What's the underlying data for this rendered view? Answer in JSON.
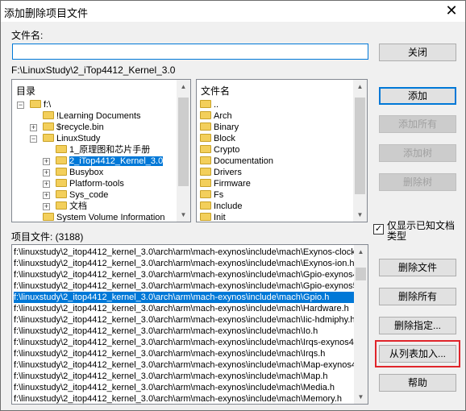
{
  "window": {
    "title": "添加删除项目文件",
    "close_glyph": "✕"
  },
  "filename_label": "文件名:",
  "filename_value": "",
  "current_path": "F:\\LinuxStudy\\2_iTop4412_Kernel_3.0",
  "dir_header": "目录",
  "file_header": "文件名",
  "dir_tree": [
    {
      "label": "f:\\",
      "expander": "−"
    },
    {
      "label": "!Learning Documents",
      "expander": ""
    },
    {
      "label": "$recycle.bin",
      "expander": "+"
    },
    {
      "label": "LinuxStudy",
      "expander": "−"
    },
    {
      "label": "1_原理图和芯片手册",
      "expander": ""
    },
    {
      "label": "2_iTop4412_Kernel_3.0",
      "expander": "+",
      "selected": true
    },
    {
      "label": "Busybox",
      "expander": "+"
    },
    {
      "label": "Platform-tools",
      "expander": "+"
    },
    {
      "label": "Sys_code",
      "expander": "+"
    },
    {
      "label": "文档",
      "expander": "+"
    },
    {
      "label": "System Volume Information",
      "expander": ""
    }
  ],
  "file_list": [
    "..",
    "Arch",
    "Binary",
    "Block",
    "Crypto",
    "Documentation",
    "Drivers",
    "Firmware",
    "Fs",
    "Include",
    "Init"
  ],
  "project_files_label": "项目文件: (3188)",
  "project_files": [
    {
      "path": "f:\\linuxstudy\\2_itop4412_kernel_3.0\\arch\\arm\\mach-exynos\\include\\mach\\Exynos-clock"
    },
    {
      "path": "f:\\linuxstudy\\2_itop4412_kernel_3.0\\arch\\arm\\mach-exynos\\include\\mach\\Exynos-ion.h"
    },
    {
      "path": "f:\\linuxstudy\\2_itop4412_kernel_3.0\\arch\\arm\\mach-exynos\\include\\mach\\Gpio-exynos4"
    },
    {
      "path": "f:\\linuxstudy\\2_itop4412_kernel_3.0\\arch\\arm\\mach-exynos\\include\\mach\\Gpio-exynos5"
    },
    {
      "path": "f:\\linuxstudy\\2_itop4412_kernel_3.0\\arch\\arm\\mach-exynos\\include\\mach\\Gpio.h",
      "selected": true
    },
    {
      "path": "f:\\linuxstudy\\2_itop4412_kernel_3.0\\arch\\arm\\mach-exynos\\include\\mach\\Hardware.h"
    },
    {
      "path": "f:\\linuxstudy\\2_itop4412_kernel_3.0\\arch\\arm\\mach-exynos\\include\\mach\\Iic-hdmiphy.h"
    },
    {
      "path": "f:\\linuxstudy\\2_itop4412_kernel_3.0\\arch\\arm\\mach-exynos\\include\\mach\\Io.h"
    },
    {
      "path": "f:\\linuxstudy\\2_itop4412_kernel_3.0\\arch\\arm\\mach-exynos\\include\\mach\\Irqs-exynos4"
    },
    {
      "path": "f:\\linuxstudy\\2_itop4412_kernel_3.0\\arch\\arm\\mach-exynos\\include\\mach\\Irqs.h"
    },
    {
      "path": "f:\\linuxstudy\\2_itop4412_kernel_3.0\\arch\\arm\\mach-exynos\\include\\mach\\Map-exynos4"
    },
    {
      "path": "f:\\linuxstudy\\2_itop4412_kernel_3.0\\arch\\arm\\mach-exynos\\include\\mach\\Map.h"
    },
    {
      "path": "f:\\linuxstudy\\2_itop4412_kernel_3.0\\arch\\arm\\mach-exynos\\include\\mach\\Media.h"
    },
    {
      "path": "f:\\linuxstudy\\2_itop4412_kernel_3.0\\arch\\arm\\mach-exynos\\include\\mach\\Memory.h"
    }
  ],
  "buttons": {
    "close": "关闭",
    "add": "添加",
    "add_all": "添加所有",
    "add_tree": "添加树",
    "delete_tree": "删除树",
    "delete_file": "删除文件",
    "delete_all": "删除所有",
    "delete_specified": "删除指定...",
    "add_from_list": "从列表加入...",
    "help": "帮助"
  },
  "show_known_types": {
    "label": "仅显示已知文档类型",
    "checked": true,
    "check_glyph": "✓"
  },
  "colors": {
    "selection": "#0078d7",
    "highlight_box": "#e0252b",
    "folder": "#f3cf5b"
  }
}
